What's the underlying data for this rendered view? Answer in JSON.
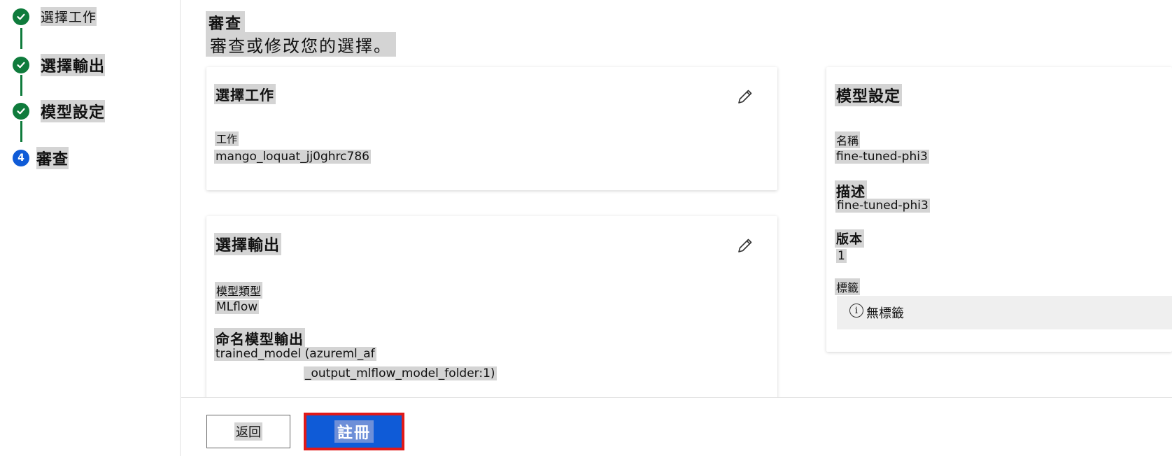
{
  "stepper": {
    "steps": [
      {
        "label": "選擇工作",
        "state": "done",
        "number": ""
      },
      {
        "label": "選擇輸出",
        "state": "done",
        "number": ""
      },
      {
        "label": "模型設定",
        "state": "done",
        "number": ""
      },
      {
        "label": "審查",
        "state": "current",
        "number": "4"
      }
    ]
  },
  "header": {
    "title": "審查",
    "subtitle": "審查或修改您的選擇。"
  },
  "card_job": {
    "title": "選擇工作",
    "field_label": "工作",
    "field_value": "mango_loquat_jj0ghrc786"
  },
  "card_output": {
    "title": "選擇輸出",
    "model_type_label": "模型類型",
    "model_type_value": "MLflow",
    "output_name_label": "命名模型輸出",
    "output_name_value_line1": "trained_model (azureml_af",
    "output_name_value_line2": "_output_mlflow_model_folder:1)"
  },
  "card_settings": {
    "title": "模型設定",
    "name_label": "名稱",
    "name_value": "fine-tuned-phi3",
    "desc_label": "描述",
    "desc_value": "fine-tuned-phi3",
    "version_label": "版本",
    "version_value": "1",
    "tags_label": "標籤",
    "tags_empty": "無標籤"
  },
  "footer": {
    "back_label": "返回",
    "register_label": "註冊"
  },
  "colors": {
    "step_done": "#0f7b3c",
    "step_current": "#0f5bd7",
    "primary_button": "#0f5bd7",
    "highlight_border": "#e01a1a"
  },
  "icons": {
    "step_done": "checkmark-icon",
    "edit": "pencil-icon",
    "info": "info-icon"
  }
}
